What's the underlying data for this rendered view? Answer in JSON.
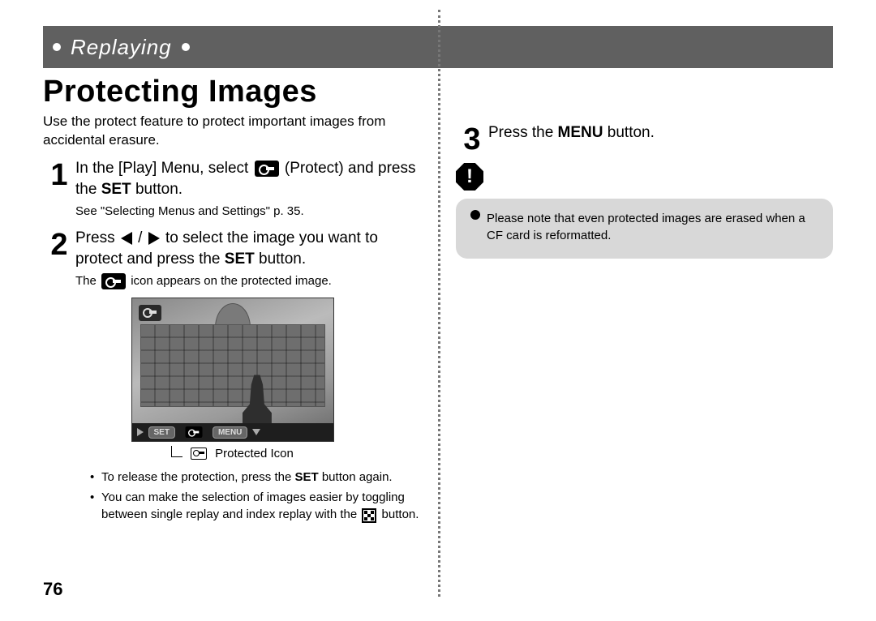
{
  "header": {
    "section_label": "Replaying"
  },
  "title": "Protecting Images",
  "intro": "Use the protect feature to protect important images from accidental erasure.",
  "steps": {
    "s1": {
      "num": "1",
      "line1": "In the [Play] Menu, select ",
      "line1b": " (Protect) and press the ",
      "bold1": "SET",
      "line1c": " button.",
      "sub": "See \"Selecting Menus and Settings\" p. 35."
    },
    "s2": {
      "num": "2",
      "pre": "Press ",
      "mid": " to select the image you want to protect and press the ",
      "bold": "SET",
      "post": " button.",
      "sub_pre": "The ",
      "sub_post": " icon appears on the protected image."
    },
    "s3": {
      "num": "3",
      "pre": "Press the ",
      "bold": "MENU",
      "post": " button."
    }
  },
  "screenshot": {
    "pill_set": "SET",
    "pill_menu": "MENU",
    "caption": "Protected Icon"
  },
  "bullets": {
    "b1_pre": "To release the protection, press the ",
    "b1_bold": "SET",
    "b1_post": " button again.",
    "b2_pre": "You can make the selection of images easier by toggling between single replay and index replay with the ",
    "b2_post": " button."
  },
  "note": "Please note that even protected images are erased when a CF card is reformatted.",
  "page_number": "76"
}
